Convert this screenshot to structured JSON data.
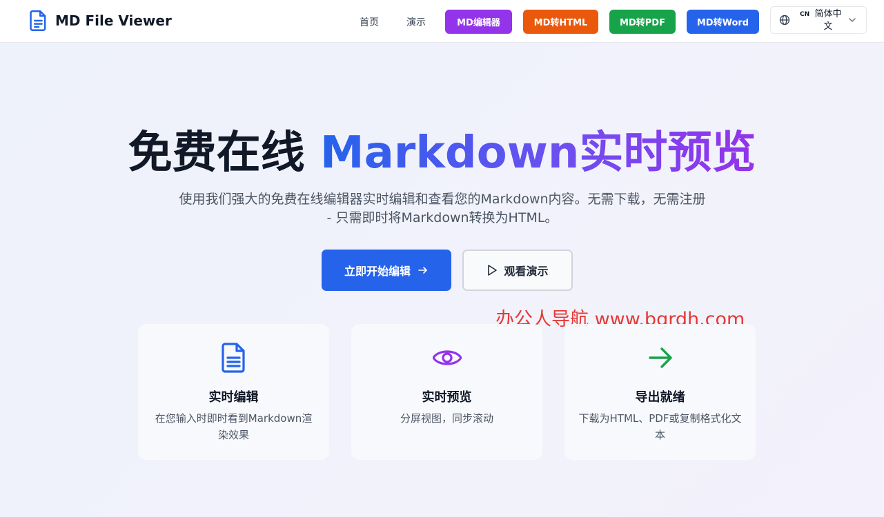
{
  "header": {
    "logo_text": "MD File Viewer",
    "nav_links": [
      "首页",
      "演示"
    ],
    "nav_buttons": [
      {
        "label": "MD编辑器",
        "color": "#9333ea"
      },
      {
        "label": "MD转HTML",
        "color": "#ea580c"
      },
      {
        "label": "MD转PDF",
        "color": "#16a34a"
      },
      {
        "label": "MD转Word",
        "color": "#2563eb"
      }
    ],
    "language": {
      "code": "CN",
      "name": "简体中文"
    }
  },
  "hero": {
    "title_prefix": "免费在线 ",
    "title_highlight": "Markdown实时预览",
    "subtitle": "使用我们强大的免费在线编辑器实时编辑和查看您的Markdown内容。无需下载，无需注册 - 只需即时将Markdown转换为HTML。",
    "primary_button": "立即开始编辑",
    "secondary_button": "观看演示"
  },
  "watermark": "办公人导航  www.bgrdh.com",
  "features": [
    {
      "title": "实时编辑",
      "description": "在您输入时即时看到Markdown渲染效果",
      "icon": "document-icon",
      "color": "#2563eb"
    },
    {
      "title": "实时预览",
      "description": "分屏视图，同步滚动",
      "icon": "eye-icon",
      "color": "#9333ea"
    },
    {
      "title": "导出就绪",
      "description": "下载为HTML、PDF或复制格式化文本",
      "icon": "arrow-right-icon",
      "color": "#16a34a"
    }
  ]
}
